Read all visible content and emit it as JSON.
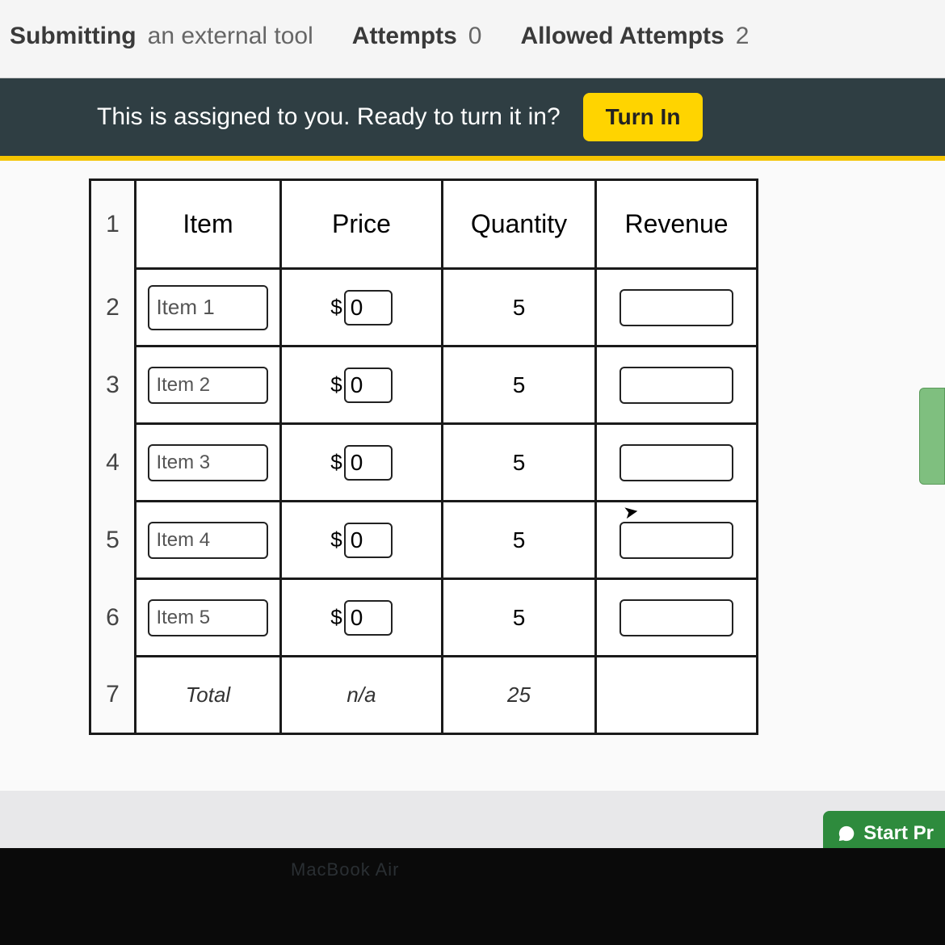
{
  "meta": {
    "submitting_label": "Submitting",
    "submitting_value": "an external tool",
    "attempts_label": "Attempts",
    "attempts_value": "0",
    "allowed_label": "Allowed Attempts",
    "allowed_value": "2"
  },
  "banner": {
    "message": "This is assigned to you. Ready to turn it in?",
    "button": "Turn In"
  },
  "table": {
    "headers": {
      "item": "Item",
      "price": "Price",
      "quantity": "Quantity",
      "revenue": "Revenue"
    },
    "rows": [
      {
        "num": "1"
      },
      {
        "num": "2",
        "item": "Item 1",
        "price_prefix": "$",
        "price": "0",
        "qty": "5"
      },
      {
        "num": "3",
        "item": "Item 2",
        "price_prefix": "$",
        "price": "0",
        "qty": "5"
      },
      {
        "num": "4",
        "item": "Item 3",
        "price_prefix": "$",
        "price": "0",
        "qty": "5"
      },
      {
        "num": "5",
        "item": "Item 4",
        "price_prefix": "$",
        "price": "0",
        "qty": "5"
      },
      {
        "num": "6",
        "item": "Item 5",
        "price_prefix": "$",
        "price": "0",
        "qty": "5"
      },
      {
        "num": "7",
        "item": "Total",
        "price_text": "n/a",
        "qty": "25"
      }
    ]
  },
  "start_button": "Start Pr",
  "device_label": "MacBook Air"
}
